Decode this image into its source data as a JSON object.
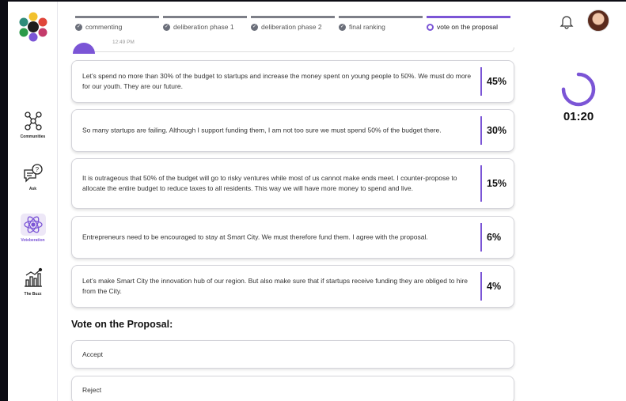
{
  "sidebar": {
    "items": [
      {
        "label": "Communities",
        "icon": "communities-icon"
      },
      {
        "label": "Ask",
        "icon": "ask-icon"
      },
      {
        "label": "Voteberation",
        "icon": "voteberation-icon",
        "active": true
      },
      {
        "label": "The Buzz",
        "icon": "buzz-icon"
      }
    ]
  },
  "stepper": {
    "steps": [
      {
        "label": "commenting",
        "state": "done"
      },
      {
        "label": "deliberation phase 1",
        "state": "done"
      },
      {
        "label": "deliberation phase 2",
        "state": "done"
      },
      {
        "label": "final ranking",
        "state": "done"
      },
      {
        "label": "vote on the proposal",
        "state": "active"
      }
    ]
  },
  "partial_card": {
    "time": "12:49 PM"
  },
  "proposals": [
    {
      "text": "Let’s spend no more than 30% of the budget to startups and increase the money spent on young people to 50%. We must do more for our youth. They are our future.",
      "percent": "45%"
    },
    {
      "text": "So many startups are failing. Although I support funding them, I am not too sure we must spend 50% of the budget there.",
      "percent": "30%"
    },
    {
      "text": "It is outrageous that 50% of the budget will go to risky ventures while most of us cannot make ends meet. I counter-propose to allocate the entire budget to reduce taxes to all residents. This way we will have more money to spend and live.",
      "percent": "15%"
    },
    {
      "text": "Entrepreneurs need to be encouraged to stay at Smart City. We must therefore fund them. I agree with the proposal.",
      "percent": "6%"
    },
    {
      "text": "Let’s make Smart City the innovation hub of our region. But also make sure that if startups receive funding they are obliged to hire from the City.",
      "percent": "4%"
    }
  ],
  "vote": {
    "title": "Vote on the Proposal:",
    "options": [
      "Accept",
      "Reject"
    ]
  },
  "timer": {
    "value": "01:20",
    "progress": 0.75
  },
  "colors": {
    "accent": "#7b55d6",
    "step_done": "#7d7f88"
  }
}
